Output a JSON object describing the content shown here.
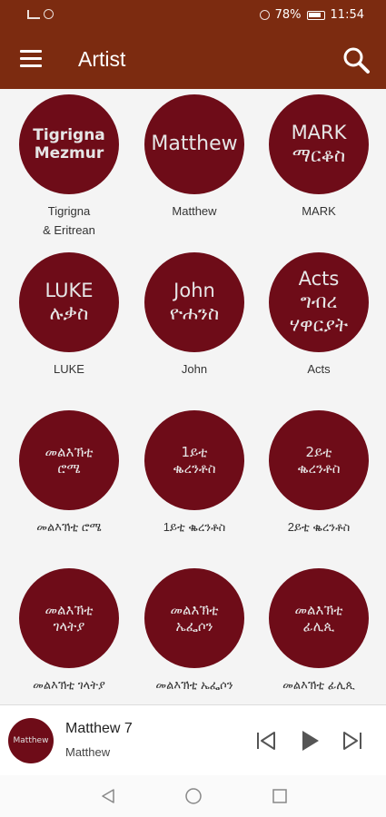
{
  "status": {
    "battery": "78%",
    "time": "11:54"
  },
  "app_bar": {
    "title": "Artist"
  },
  "artists": [
    {
      "disc": "Tigrigna\nMezmur",
      "caption": "Tigrigna\n& Eritrean"
    },
    {
      "disc": "Matthew",
      "caption": "Matthew"
    },
    {
      "disc": "MARK\nማርቆስ",
      "caption": "MARK"
    },
    {
      "disc": "LUKE\nሉቃስ",
      "caption": "LUKE"
    },
    {
      "disc": "John\nዮሐንስ",
      "caption": "John"
    },
    {
      "disc": "Acts\nግብረ\nሃዋርያት",
      "caption": "Acts"
    },
    {
      "disc": "መልእኽቲ\nሮሜ",
      "caption": "መልእኽቲ ሮሜ"
    },
    {
      "disc": "1ይቲ\nቈረንቶስ",
      "caption": "1ይቲ ቈረንቶስ"
    },
    {
      "disc": "2ይቲ\nቈረንቶስ",
      "caption": "2ይቲ ቈረንቶስ"
    },
    {
      "disc": "መልእኽቲ\nገላትያ",
      "caption": "መልእኽቲ ገላትያ"
    },
    {
      "disc": "መልእኽቲ\nኤፌሶን",
      "caption": "መልእኽቲ ኤፌሶን"
    },
    {
      "disc": "መልእኽቲ\nፊሊጲ",
      "caption": "መልእኽቲ ፊሊጲ"
    }
  ],
  "player": {
    "thumb_label": "Matthew",
    "title": "Matthew 7",
    "subtitle": "Matthew"
  },
  "colors": {
    "primary": "#7c2b10",
    "disc": "#6e0c18",
    "control": "#555555"
  },
  "icons": {
    "menu": "hamburger-icon",
    "search": "search-icon",
    "prev": "skip-previous-icon",
    "play": "play-icon",
    "next": "skip-next-icon",
    "nav_back": "back-triangle-icon",
    "nav_home": "home-circle-icon",
    "nav_recent": "recent-square-icon"
  }
}
